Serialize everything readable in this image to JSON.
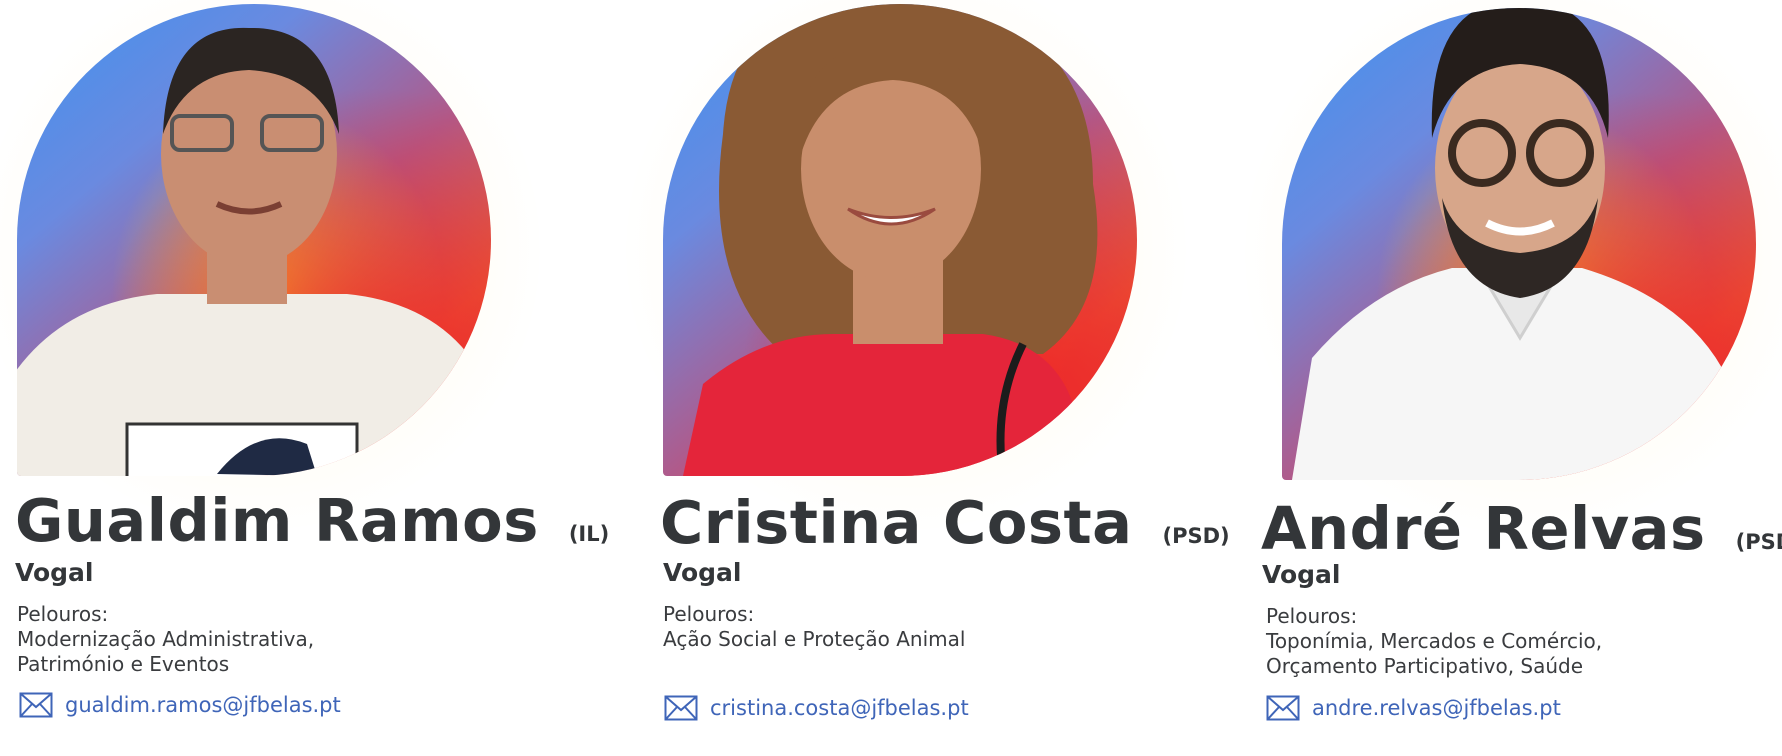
{
  "members": [
    {
      "name": "Gualdim Ramos",
      "party": "(IL)",
      "role": "Vogal",
      "pelouros_label": "Pelouros:",
      "pelouros": [
        "Modernização Administrativa,",
        "Património e Eventos"
      ],
      "email": "gualdim.ramos@jfbelas.pt",
      "email_icon": "mail-icon",
      "photo_colors": {
        "hair": "#2b2522",
        "skin": "#c98e72",
        "shirt": "#f1ede6"
      }
    },
    {
      "name": "Cristina Costa",
      "party": "(PSD)",
      "role": "Vogal",
      "pelouros_label": "Pelouros:",
      "pelouros": [
        "Ação Social e Proteção Animal"
      ],
      "email": "cristina.costa@jfbelas.pt",
      "email_icon": "mail-icon",
      "photo_colors": {
        "hair": "#8a5a34",
        "skin": "#c98e6c",
        "shirt": "#e4253a"
      }
    },
    {
      "name": "André Relvas",
      "party": "(PSD)",
      "role": "Vogal",
      "pelouros_label": "Pelouros:",
      "pelouros": [
        "Toponímia, Mercados e Comércio,",
        "Orçamento Participativo, Saúde"
      ],
      "email": "andre.relvas@jfbelas.pt",
      "email_icon": "mail-icon",
      "photo_colors": {
        "hair": "#241d1a",
        "skin": "#d7a68a",
        "shirt": "#f6f6f6"
      }
    }
  ],
  "colors": {
    "text": "#333639",
    "link": "#3f65b8",
    "gradient": [
      "#3f92ef",
      "#b05a8a",
      "#f4c430",
      "#e02a30"
    ]
  }
}
